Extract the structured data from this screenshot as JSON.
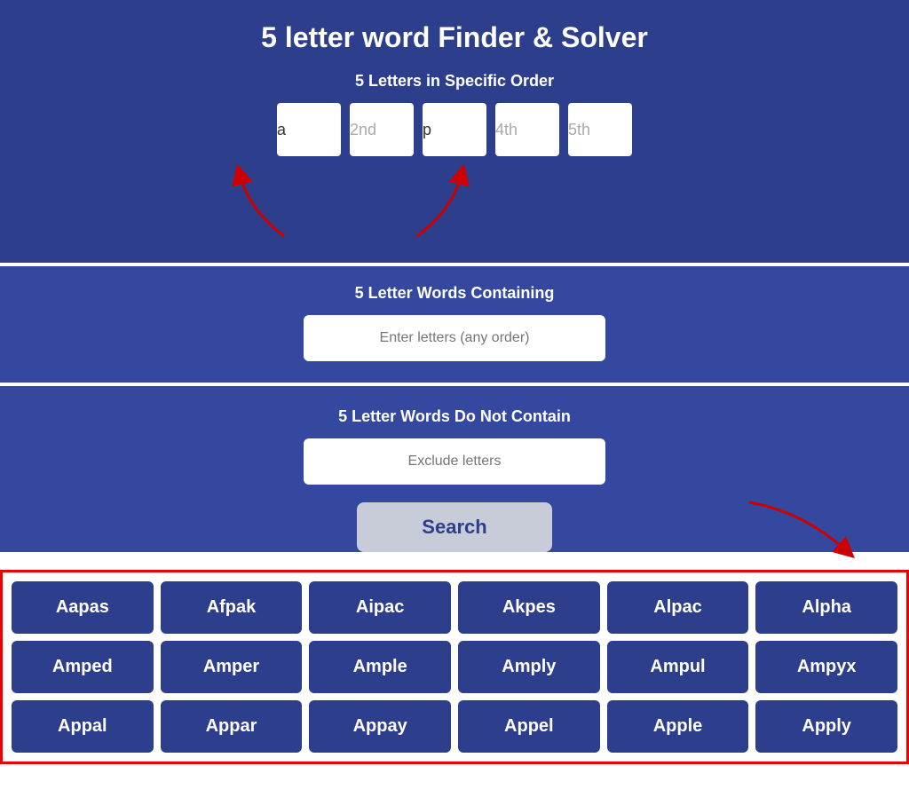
{
  "title": "5 letter word Finder & Solver",
  "specificOrder": {
    "label": "5 Letters in Specific Order",
    "boxes": [
      {
        "value": "a",
        "placeholder": ""
      },
      {
        "value": "2nd",
        "placeholder": ""
      },
      {
        "value": "p",
        "placeholder": ""
      },
      {
        "value": "4th",
        "placeholder": ""
      },
      {
        "value": "5th",
        "placeholder": ""
      }
    ]
  },
  "containing": {
    "label": "5 Letter Words Containing",
    "placeholder": "Enter letters (any order)"
  },
  "doNotContain": {
    "label": "5 Letter Words Do Not Contain",
    "placeholder": "Exclude letters"
  },
  "searchButton": "Search",
  "results": {
    "words": [
      "Aapas",
      "Afpak",
      "Aipac",
      "Akpes",
      "Alpac",
      "Alpha",
      "Amped",
      "Amper",
      "Ample",
      "Amply",
      "Ampul",
      "Ampyx",
      "Appal",
      "Appar",
      "Appay",
      "Appel",
      "Apple",
      "Apply"
    ]
  }
}
